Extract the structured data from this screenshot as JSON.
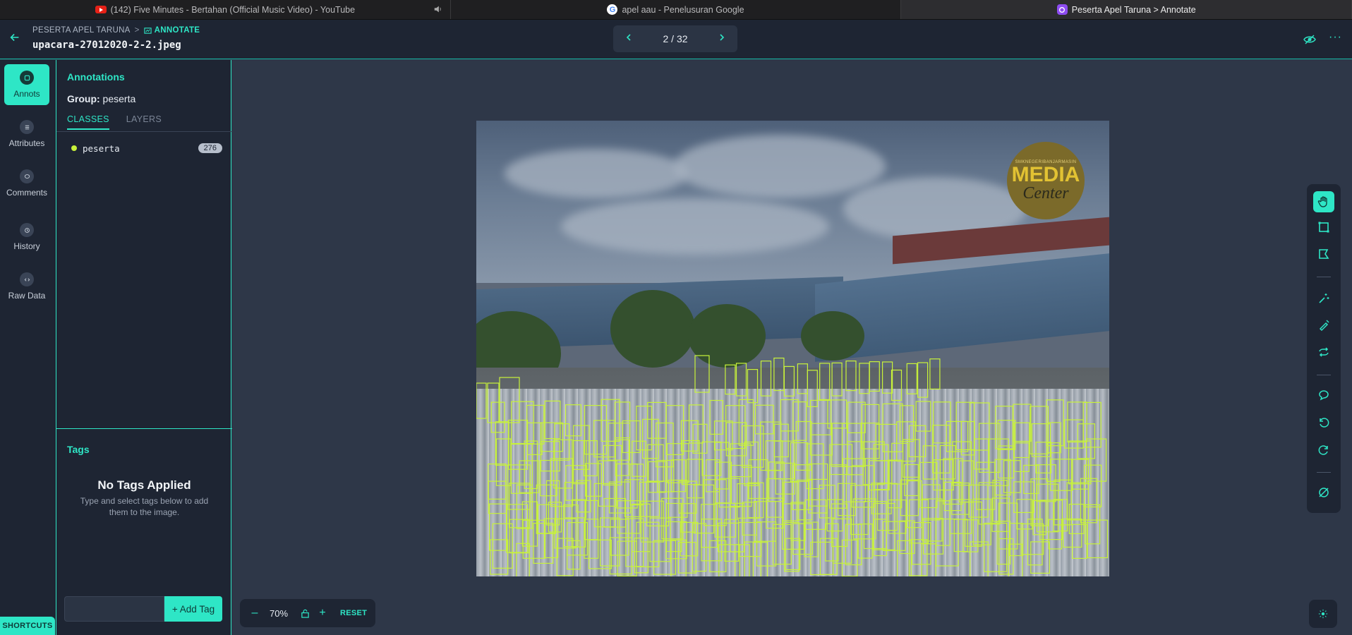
{
  "browser": {
    "tabs": [
      {
        "title": "(142) Five Minutes - Bertahan (Official Music Video) - YouTube",
        "icon": "youtube-icon"
      },
      {
        "title": "apel aau - Penelusuran Google",
        "icon": "google-icon"
      },
      {
        "title": "Peserta Apel Taruna > Annotate",
        "icon": "v7-icon"
      }
    ]
  },
  "header": {
    "breadcrumb_dataset": "PESERTA APEL TARUNA",
    "breadcrumb_separator": ">",
    "breadcrumb_mode": "ANNOTATE",
    "filename": "upacara-27012020-2-2.jpeg",
    "pager": "2 / 32"
  },
  "rail": {
    "items": [
      {
        "label": "Annots",
        "icon": "annotations-icon"
      },
      {
        "label": "Attributes",
        "icon": "list-icon"
      },
      {
        "label": "Comments",
        "icon": "comment-icon"
      },
      {
        "label": "History",
        "icon": "history-icon"
      },
      {
        "label": "Raw Data",
        "icon": "code-icon"
      }
    ],
    "shortcuts": "SHORTCUTS"
  },
  "panel": {
    "title": "Annotations",
    "group_label": "Group:",
    "group_value": "peserta",
    "tabs": [
      "CLASSES",
      "LAYERS"
    ],
    "classes": [
      {
        "name": "peserta",
        "count": "276",
        "color": "#c8f23a"
      }
    ],
    "tags_title": "Tags",
    "no_tags_heading": "No Tags Applied",
    "no_tags_text": "Type and select tags below to add them to the image.",
    "tag_input_value": "",
    "add_tag": "+ Add Tag"
  },
  "image": {
    "logo_small": "SMKNEGERIBANJARMASIN",
    "logo_big": "MEDIA",
    "logo_script": "Center",
    "box_color": "#c8f23a"
  },
  "toolbar": {
    "tools": [
      "hand-icon",
      "bounding-box-icon",
      "polygon-icon",
      "auto-annotate-icon",
      "brush-icon",
      "repeat-icon",
      "comment-icon",
      "undo-icon",
      "redo-icon",
      "hide-icon"
    ]
  },
  "zoom": {
    "value": "70%",
    "reset": "RESET"
  },
  "colors": {
    "accent": "#2ee6c6",
    "panel_bg": "#1e2533",
    "canvas_bg": "#2e3748"
  }
}
